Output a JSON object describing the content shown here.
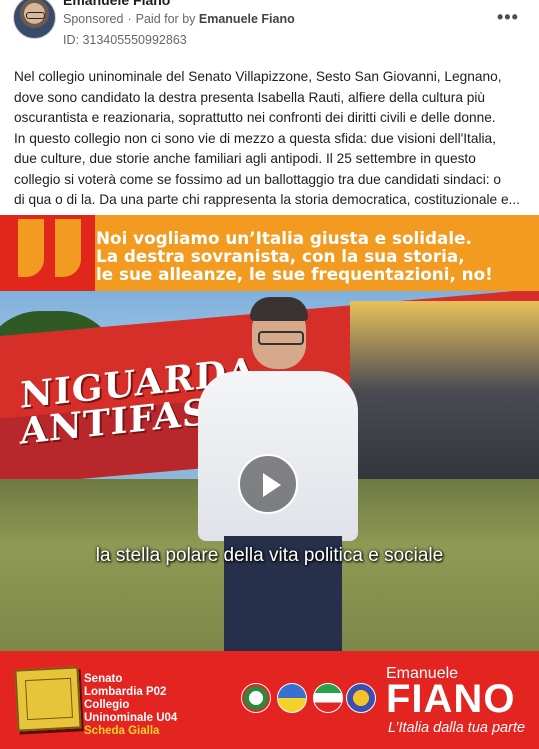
{
  "header": {
    "advertiser": "Emanuele Fiano",
    "sponsored_label": "Sponsored",
    "paid_for_prefix": "Paid for by",
    "paid_for_name": "Emanuele Fiano",
    "ad_id": "ID: 313405550992863",
    "more_label": "•••"
  },
  "post": {
    "lines": [
      "Nel collegio uninominale del Senato Villapizzone, Sesto San Giovanni, Legnano,",
      "dove sono candidato la destra presenta Isabella Rauti, alfiere della cultura più",
      "oscurantista e reazionaria, soprattutto nei confronti dei diritti civili e delle donne.",
      "In questo collegio non ci sono vie di mezzo a questa sfida: due visioni dell'Italia,",
      "due culture, due storie anche familiari agli antipodi. Il 25 settembre in questo",
      "collegio si voterà come se fossimo ad un ballottaggio tra due candidati sindaci: o",
      "di qua o di la. Da una parte chi rappresenta la storia democratica, costituzionale e..."
    ]
  },
  "banner": {
    "line1": "Noi vogliamo un’Italia giusta e solidale.",
    "line2": "La destra sovranista, con la sua storia,",
    "line3": "le sue alleanze, le sue frequentazioni, no!",
    "colors": {
      "background": "#f39a20",
      "quote": "#e1261c",
      "text": "#ffffff"
    }
  },
  "video": {
    "mural_line1": "NIGUARDA",
    "mural_line2": "ANTIFASCISTA",
    "caption": "la stella polare della vita politica e sociale",
    "play_icon": "play-icon"
  },
  "footer": {
    "left_lines": [
      "Senato",
      "Lombardia P02",
      "Collegio",
      "Uninominale U04"
    ],
    "left_highlight": "Scheda Gialla",
    "candidate_first": "Emanuele",
    "candidate_last": "FIANO",
    "slogan": "L’Italia dalla tua parte",
    "logo_labels": [
      "PD",
      "EUROPA",
      "",
      "IMPEGNO CIVICO"
    ],
    "colors": {
      "background": "#e42420",
      "highlight": "#f5d42a"
    }
  }
}
